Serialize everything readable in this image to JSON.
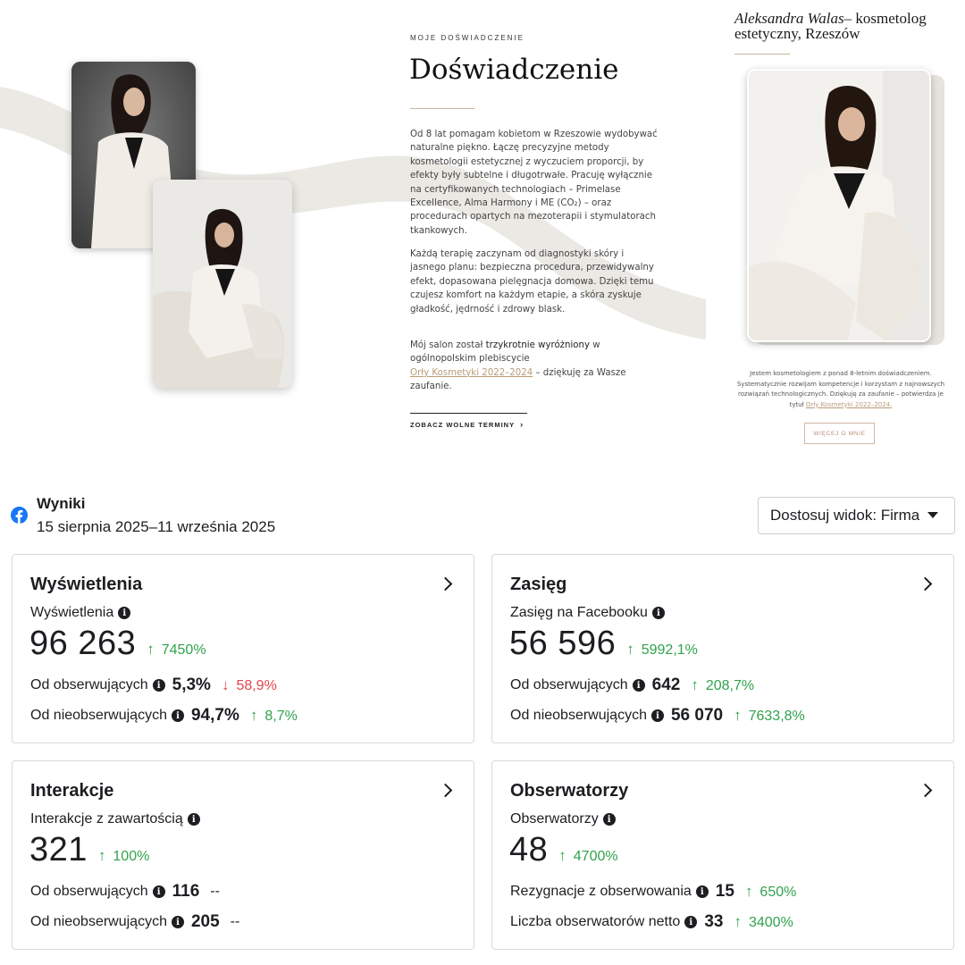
{
  "site": {
    "eyebrow": "MOJE DOŚWIADCZENIE",
    "title": "Doświadczenie",
    "para1": "Od 8 lat pomagam kobietom w Rzeszowie wydobywać naturalne piękno. Łączę precyzyjne metody kosmetologii estetycznej z wyczuciem proporcji, by efekty były subtelne i długotrwałe. Pracuję wyłącznie na certyfikowanych technologiach – Primelase Excellence, Alma Harmony i ME (CO₂) – oraz procedurach opartych na mezoterapii i stymulatorach tkankowych.",
    "para2": "Każdą terapię zaczynam od diagnostyki skóry i jasnego planu: bezpieczna procedura, przewidywalny efekt, dopasowana pielęgnacja domowa. Dzięki temu czujesz komfort na każdym etapie, a skóra zyskuje gładkość, jędrność i zdrowy blask.",
    "para3_a": "Mój salon został ",
    "para3_strong": "trzykrotnie wyróżniony",
    "para3_b": " w ogólnopolskim plebiscycie ",
    "para3_link": "Orły Kosmetyki 2022–2024",
    "para3_c": " – dziękuję za Wasze zaufanie.",
    "cta": "ZOBACZ WOLNE TERMINY",
    "cta_chevron": "›",
    "bio_name_italic": "Aleksandra Walas",
    "bio_name_rest": "– kosmetolog estetyczny, Rzeszów",
    "bio_desc": "Jestem kosmetologiem z ponad 8-letnim doświadczeniem. Systematycznie rozwijam kompetencje i korzystam z najnowszych rozwiązań technologicznych. Dziękuję za zaufanie – potwierdza je tytuł ",
    "bio_link": "Orły Kosmetyki 2022–2024.",
    "more_button": "WIĘCEJ O MNIE"
  },
  "insights": {
    "title": "Wyniki",
    "date_range": "15 sierpnia 2025–11 września 2025",
    "view_select": "Dostosuj widok: Firma",
    "info_glyph": "i",
    "cards": [
      {
        "title": "Wyświetlenia",
        "subtitle": "Wyświetlenia",
        "value": "96 263",
        "delta": "7450%",
        "rows": [
          {
            "label": "Od obserwujących",
            "value": "5,3%",
            "delta": "58,9%"
          },
          {
            "label": "Od nieobserwujących",
            "value": "94,7%",
            "delta": "8,7%"
          }
        ]
      },
      {
        "title": "Zasięg",
        "subtitle": "Zasięg na Facebooku",
        "value": "56 596",
        "delta": "5992,1%",
        "rows": [
          {
            "label": "Od obserwujących",
            "value": "642",
            "delta": "208,7%"
          },
          {
            "label": "Od nieobserwujących",
            "value": "56 070",
            "delta": "7633,8%"
          }
        ]
      },
      {
        "title": "Interakcje",
        "subtitle": "Interakcje z zawartością",
        "value": "321",
        "delta": "100%",
        "rows": [
          {
            "label": "Od obserwujących",
            "value": "116",
            "delta": "--"
          },
          {
            "label": "Od nieobserwujących",
            "value": "205",
            "delta": "--"
          }
        ]
      },
      {
        "title": "Obserwatorzy",
        "subtitle": "Obserwatorzy",
        "value": "48",
        "delta": "4700%",
        "rows": [
          {
            "label": "Rezygnacje z obserwowania",
            "value": "15",
            "delta": "650%"
          },
          {
            "label": "Liczba obserwatorów netto",
            "value": "33",
            "delta": "3400%"
          }
        ]
      }
    ],
    "arrows": {
      "up": "↑",
      "down": "↓"
    }
  },
  "colors": {
    "up": "#31a24c",
    "down": "#e0454b",
    "facebook": "#1877f2",
    "gold": "#b89b78"
  },
  "icons": [
    "facebook-icon",
    "info-icon",
    "chevron-right-icon",
    "caret-down-icon",
    "arrow-up-icon",
    "arrow-down-icon"
  ]
}
